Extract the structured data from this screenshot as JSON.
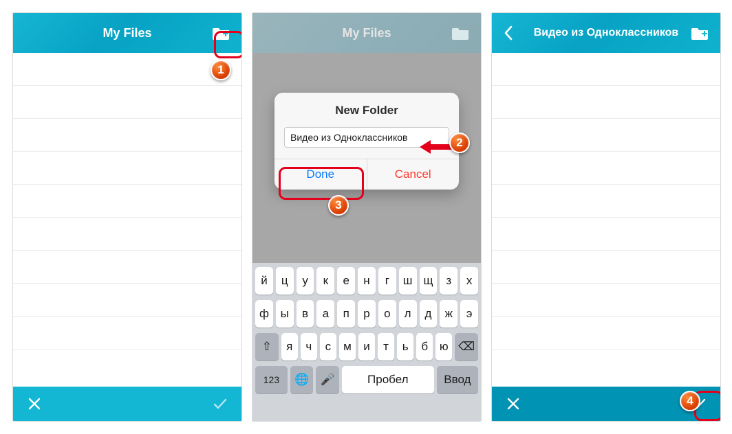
{
  "accent": "#13b6d3",
  "steps": {
    "s1": "1",
    "s2": "2",
    "s3": "3",
    "s4": "4"
  },
  "screen1": {
    "title": "My Files"
  },
  "screen2": {
    "title": "My Files",
    "dialog": {
      "title": "New Folder",
      "input_value": "Видео из Одноклассников",
      "done": "Done",
      "cancel": "Cancel"
    },
    "keyboard": {
      "row1": [
        "й",
        "ц",
        "у",
        "к",
        "е",
        "н",
        "г",
        "ш",
        "щ",
        "з",
        "х"
      ],
      "row2": [
        "ф",
        "ы",
        "в",
        "а",
        "п",
        "р",
        "о",
        "л",
        "д",
        "ж",
        "э"
      ],
      "row3_shift": "⇧",
      "row3": [
        "я",
        "ч",
        "с",
        "м",
        "и",
        "т",
        "ь",
        "б",
        "ю"
      ],
      "row3_back": "⌫",
      "row4_num": "123",
      "row4_globe": "🌐",
      "row4_mic": "🎤",
      "row4_space": "Пробел",
      "row4_enter": "Ввод"
    }
  },
  "screen3": {
    "title": "Видео из Одноклассников"
  }
}
